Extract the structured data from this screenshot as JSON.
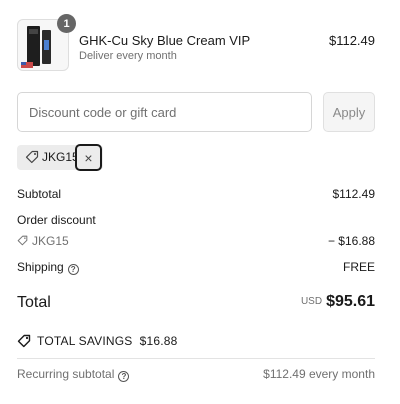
{
  "product": {
    "name": "GHK-Cu Sky Blue Cream VIP",
    "subtitle": "Deliver every month",
    "price": "$112.49",
    "quantity": "1"
  },
  "discount": {
    "placeholder": "Discount code or gift card",
    "apply_label": "Apply",
    "applied_code": "JKG15",
    "remove_symbol": "×"
  },
  "summary": {
    "subtotal_label": "Subtotal",
    "subtotal_value": "$112.49",
    "order_discount_label": "Order discount",
    "discount_code": "JKG15",
    "discount_value": "− $16.88",
    "shipping_label": "Shipping",
    "shipping_value": "FREE",
    "total_label": "Total",
    "currency": "USD",
    "total_value": "$95.61",
    "savings_label": "TOTAL SAVINGS",
    "savings_value": "$16.88",
    "recurring_label": "Recurring subtotal",
    "recurring_value": "$112.49 every month"
  },
  "icons": {
    "help": "?"
  },
  "colors": {
    "badge": "#666666",
    "muted_text": "#707070",
    "chip_bg": "#ececec"
  }
}
